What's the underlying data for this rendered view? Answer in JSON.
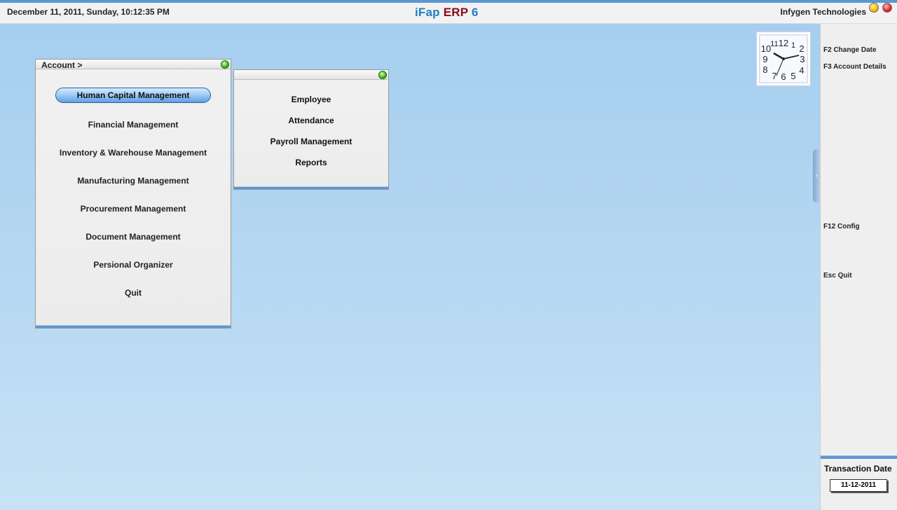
{
  "topbar": {
    "datetime": "December  11, 2011, Sunday, 10:12:35 PM",
    "app_title_1": "iFap",
    "app_title_2": "ERP",
    "app_title_3": "6",
    "company": "Infygen Technologies"
  },
  "account_menu": {
    "title": "Account >",
    "items": [
      {
        "label": "Human Capital Management",
        "selected": true
      },
      {
        "label": "Financial Management"
      },
      {
        "label": "Inventory & Warehouse Management"
      },
      {
        "label": "Manufacturing Management"
      },
      {
        "label": "Procurement Management"
      },
      {
        "label": "Document Management"
      },
      {
        "label": "Persional Organizer"
      },
      {
        "label": "Quit"
      }
    ]
  },
  "submenu": {
    "items": [
      {
        "label": "Employee"
      },
      {
        "label": "Attendance"
      },
      {
        "label": "Payroll Management"
      },
      {
        "label": "Reports"
      }
    ]
  },
  "side_panel": {
    "shortcuts": [
      {
        "label": "F2 Change Date"
      },
      {
        "label": "F3 Account Details"
      },
      {
        "label": "F12 Config"
      },
      {
        "label": "Esc Quit"
      }
    ],
    "transaction_label": "Transaction Date",
    "transaction_date": "11-12-2011"
  },
  "clock": {
    "numerals": [
      "12",
      "1",
      "2",
      "3",
      "4",
      "5",
      "6",
      "7",
      "8",
      "9",
      "10",
      "11"
    ]
  },
  "colors": {
    "accent": "#5b97d1",
    "title_blue": "#1e7fc0",
    "title_red": "#8b0a18"
  }
}
